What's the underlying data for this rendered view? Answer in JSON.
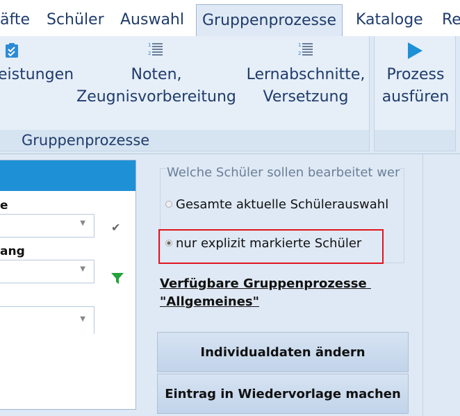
{
  "menu": {
    "tabs": [
      {
        "label": "äfte"
      },
      {
        "label": "Schüler"
      },
      {
        "label": "Auswahl"
      },
      {
        "label": "Gruppenprozesse",
        "active": true
      },
      {
        "label": "Kataloge"
      },
      {
        "label": "Re"
      }
    ]
  },
  "ribbon": {
    "group_caption": "Gruppenprozesse",
    "buttons": [
      {
        "line1": "eistungen",
        "line2": "",
        "icon": "checklist-icon"
      },
      {
        "line1": "Noten,",
        "line2": "Zeugnisvorbereitung",
        "icon": "numbered-list-icon"
      },
      {
        "line1": "Lernabschnitte,",
        "line2": "Versetzung",
        "icon": "numbered-list-icon"
      },
      {
        "line1": "Prozess",
        "line2": "ausfüren",
        "icon": "play-icon"
      }
    ]
  },
  "left_panel": {
    "label1": "e",
    "label2": "ang"
  },
  "right_panel": {
    "legend": "Welche Schüler sollen bearbeitet wer",
    "option_all": "Gesamte aktuelle Schülerauswahl",
    "option_marked": "nur explizit markierte Schüler",
    "section_title_line1": "Verfügbare Gruppenprozesse ",
    "section_title_line2": "\"Allgemeines\"",
    "btn_individual": "Individualdaten ändern",
    "btn_wiedervorlage": "Eintrag in Wiedervorlage machen"
  },
  "colors": {
    "accent": "#1e90d6",
    "highlight_border": "#e0141e",
    "ribbon_text": "#1f3c6b"
  }
}
